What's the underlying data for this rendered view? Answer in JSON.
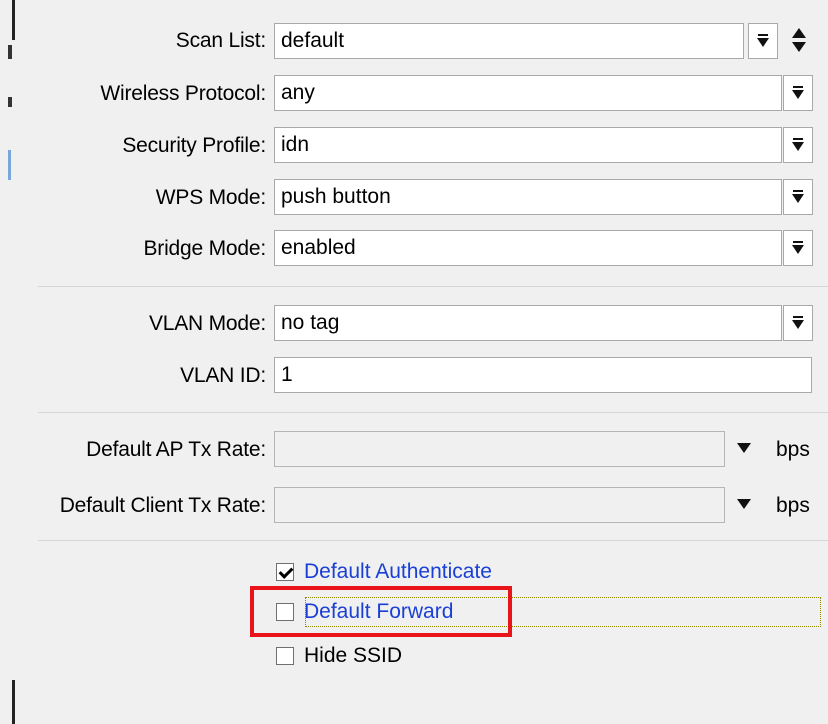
{
  "form": {
    "scan_list": {
      "label": "Scan List:",
      "value": "default"
    },
    "wireless_protocol": {
      "label": "Wireless Protocol:",
      "value": "any"
    },
    "security_profile": {
      "label": "Security Profile:",
      "value": "idn"
    },
    "wps_mode": {
      "label": "WPS Mode:",
      "value": "push button"
    },
    "bridge_mode": {
      "label": "Bridge Mode:",
      "value": "enabled"
    },
    "vlan_mode": {
      "label": "VLAN Mode:",
      "value": "no tag"
    },
    "vlan_id": {
      "label": "VLAN ID:",
      "value": "1"
    },
    "default_ap_tx_rate": {
      "label": "Default AP Tx Rate:",
      "value": "",
      "unit": "bps"
    },
    "default_client_tx_rate": {
      "label": "Default Client Tx Rate:",
      "value": "",
      "unit": "bps"
    }
  },
  "checkboxes": [
    {
      "label": "Default Authenticate",
      "checked": true,
      "style": "link"
    },
    {
      "label": "Default Forward",
      "checked": false,
      "style": "link",
      "focused": true,
      "highlighted": true
    },
    {
      "label": "Hide SSID",
      "checked": false,
      "style": "plain"
    }
  ],
  "icons": {
    "dropdown": "dropdown-arrow-icon",
    "updown": "up-down-arrows-icon",
    "small_dropdown": "triangle-down-icon"
  },
  "colors": {
    "link": "#1a3fd6",
    "highlight_box": "#e8141a",
    "background": "#f0f0f0"
  }
}
